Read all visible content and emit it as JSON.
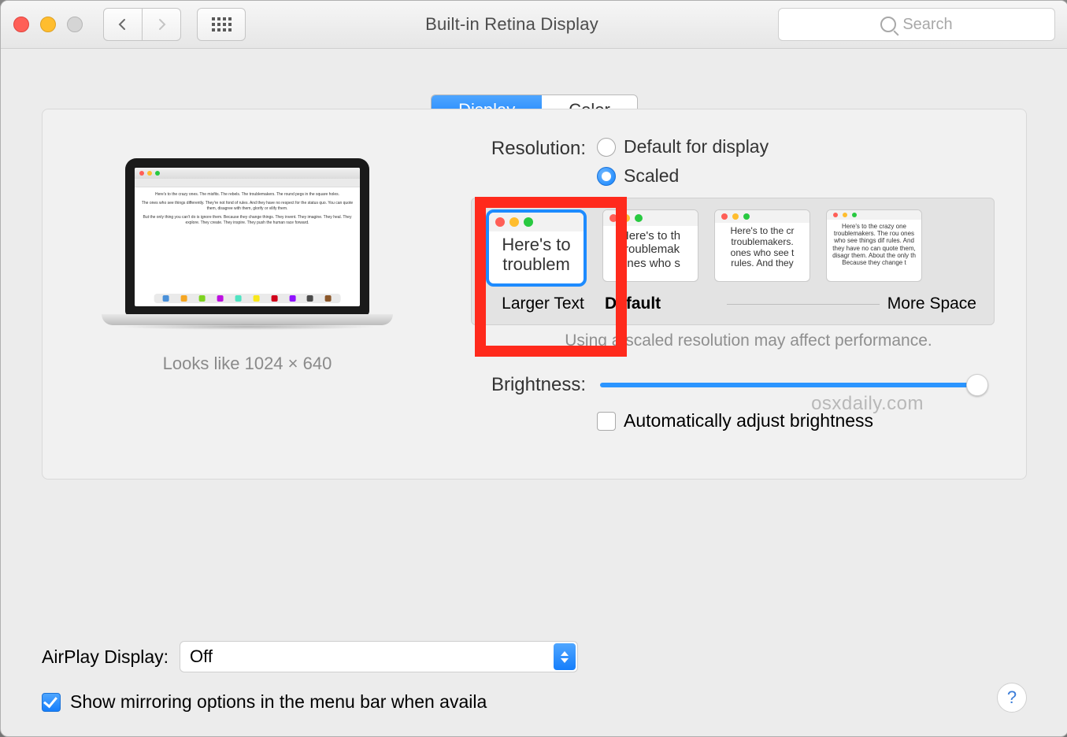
{
  "window": {
    "title": "Built-in Retina Display"
  },
  "toolbar": {
    "search_placeholder": "Search"
  },
  "tabs": {
    "display": "Display",
    "color": "Color"
  },
  "preview": {
    "looks_like": "Looks like 1024 × 640",
    "doc_p1": "Here's to the crazy ones. The misfits. The rebels. The troublemakers. The round pegs in the square holes.",
    "doc_p2": "The ones who see things differently. They're not fond of rules. And they have no respect for the status quo. You can quote them, disagree with them, glorify or vilify them.",
    "doc_p3": "But the only thing you can't do is ignore them. Because they change things. They invent. They imagine. They heal. They explore. They create. They inspire. They push the human race forward."
  },
  "resolution": {
    "label": "Resolution:",
    "opt_default": "Default for display",
    "opt_scaled": "Scaled",
    "scale_larger": "Larger Text",
    "scale_default": "Default",
    "scale_more": "More Space",
    "note": "Using a scaled resolution may affect performance.",
    "thumb1_text": "Here's to troublem",
    "thumb2_text": "Here's to th troublemak ones who s",
    "thumb3_text": "Here's to the cr troublemakers. ones who see t rules. And they",
    "thumb4_text": "Here's to the crazy one troublemakers. The rou ones who see things dif rules. And they have no can quote them, disagr them. About the only th Because they change t"
  },
  "brightness": {
    "label": "Brightness:",
    "auto_label": "Automatically adjust brightness"
  },
  "airplay": {
    "label": "AirPlay Display:",
    "value": "Off"
  },
  "mirror": {
    "label": "Show mirroring options in the menu bar when availa"
  },
  "watermark": "osxdaily.com",
  "help": "?"
}
